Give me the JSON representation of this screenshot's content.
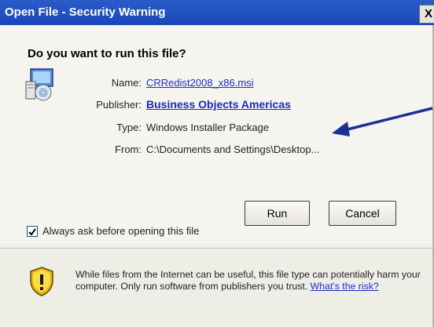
{
  "window": {
    "title": "Open File - Security Warning",
    "close_glyph": "X"
  },
  "question": "Do you want to run this file?",
  "app_icon": "installer-package-icon",
  "fields": {
    "name_label": "Name:",
    "name_value": "CRRedist2008_x86.msi",
    "publisher_label": "Publisher:",
    "publisher_value": "Business Objects Americas",
    "type_label": "Type:",
    "type_value": "Windows Installer Package",
    "from_label": "From:",
    "from_value": "C:\\Documents and Settings\\Desktop..."
  },
  "buttons": {
    "run_label": "Run",
    "cancel_label": "Cancel"
  },
  "checkbox": {
    "label": "Always ask before opening this file",
    "checked": true
  },
  "warning": {
    "text": "While files from the Internet can be useful, this file type can potentially harm your computer. Only run software from publishers you trust. ",
    "link_label": "What's the risk?",
    "icon": "warning-shield-icon"
  },
  "annotation": {
    "arrow_icon": "pointer-arrow-icon",
    "arrow_color": "#1a2f9a"
  },
  "colors": {
    "titlebar": "#2a5cc9",
    "link": "#2030c8"
  }
}
